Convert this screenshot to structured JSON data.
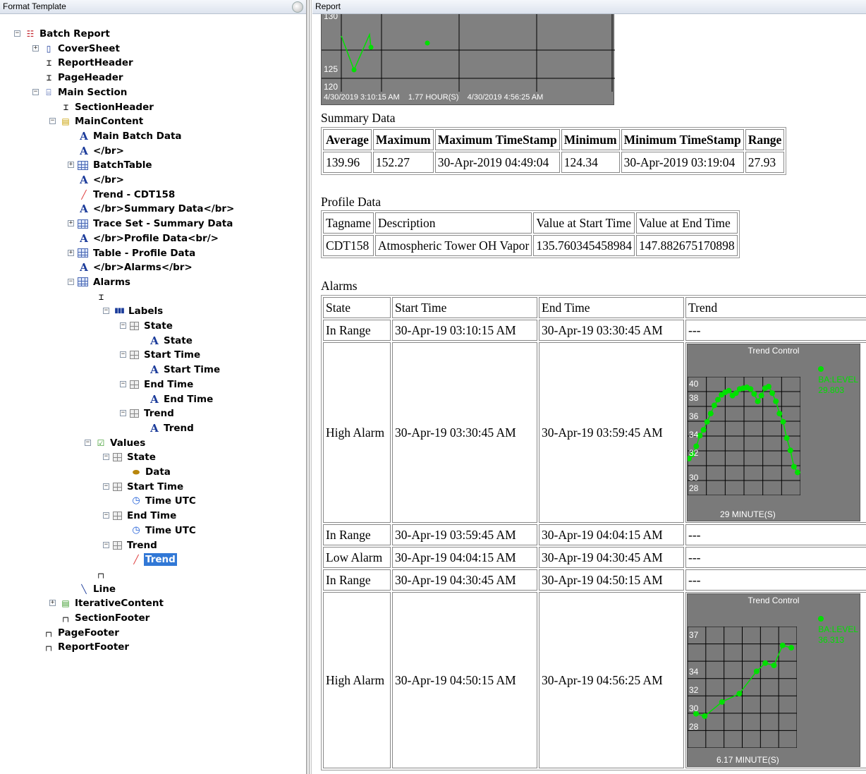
{
  "left_pane": {
    "title": "Format Template"
  },
  "right_pane": {
    "title": "Report"
  },
  "tree": [
    {
      "label": "Batch  Report",
      "icon": "batch-icon"
    },
    {
      "label": "CoverSheet",
      "icon": "document-icon"
    },
    {
      "label": "ReportHeader",
      "icon": "header-icon"
    },
    {
      "label": "PageHeader",
      "icon": "header-icon"
    },
    {
      "label": "Main Section",
      "icon": "section-icon"
    },
    {
      "label": "SectionHeader",
      "icon": "header-icon"
    },
    {
      "label": "MainContent",
      "icon": "folder-icon"
    },
    {
      "label": "Main Batch Data",
      "icon": "text-icon"
    },
    {
      "label": "</br>",
      "icon": "text-icon"
    },
    {
      "label": "BatchTable",
      "icon": "table-icon"
    },
    {
      "label": "</br>",
      "icon": "text-icon"
    },
    {
      "label": "Trend - CDT158",
      "icon": "trend-icon"
    },
    {
      "label": "</br>Summary Data</br>",
      "icon": "text-icon"
    },
    {
      "label": "Trace Set - Summary Data",
      "icon": "table-icon"
    },
    {
      "label": "</br>Profile Data<br/>",
      "icon": "text-icon"
    },
    {
      "label": "Table - Profile Data",
      "icon": "table-icon"
    },
    {
      "label": "</br>Alarms</br>",
      "icon": "text-icon"
    },
    {
      "label": "Alarms",
      "icon": "table-icon"
    },
    {
      "label": "",
      "icon": "header-icon"
    },
    {
      "label": "Labels",
      "icon": "labels-icon"
    },
    {
      "label": "State",
      "icon": "cell-icon"
    },
    {
      "label": "State",
      "icon": "text-icon"
    },
    {
      "label": "Start Time",
      "icon": "cell-icon"
    },
    {
      "label": "Start Time",
      "icon": "text-icon"
    },
    {
      "label": "End Time",
      "icon": "cell-icon"
    },
    {
      "label": "End Time",
      "icon": "text-icon"
    },
    {
      "label": "Trend",
      "icon": "cell-icon"
    },
    {
      "label": "Trend",
      "icon": "text-icon"
    },
    {
      "label": "Values",
      "icon": "values-icon"
    },
    {
      "label": "State",
      "icon": "cell-icon"
    },
    {
      "label": "Data",
      "icon": "tag-icon"
    },
    {
      "label": "Start Time",
      "icon": "cell-icon"
    },
    {
      "label": "Time UTC",
      "icon": "clock-icon"
    },
    {
      "label": "End Time",
      "icon": "cell-icon"
    },
    {
      "label": "Time UTC",
      "icon": "clock-icon"
    },
    {
      "label": "Trend",
      "icon": "cell-icon"
    },
    {
      "label": "Trend",
      "icon": "trend-icon"
    },
    {
      "label": "",
      "icon": "footer-icon"
    },
    {
      "label": "Line",
      "icon": "line-icon"
    },
    {
      "label": "IterativeContent",
      "icon": "folder-check-icon"
    },
    {
      "label": "SectionFooter",
      "icon": "footer-icon"
    },
    {
      "label": "PageFooter",
      "icon": "footer-icon"
    },
    {
      "label": "ReportFooter",
      "icon": "footer-icon"
    }
  ],
  "top_trend": {
    "y_labels": [
      "130",
      "125",
      "120"
    ],
    "start": "4/30/2019 3:10:15 AM",
    "duration": "1.77 HOUR(S)",
    "end": "4/30/2019 4:56:25 AM"
  },
  "summary": {
    "title": "Summary Data",
    "headers": [
      "Average",
      "Maximum",
      "Maximum TimeStamp",
      "Minimum",
      "Minimum TimeStamp",
      "Range"
    ],
    "row": [
      "139.96",
      "152.27",
      "30-Apr-2019 04:49:04",
      "124.34",
      "30-Apr-2019 03:19:04",
      "27.93"
    ]
  },
  "profile": {
    "title": "Profile Data",
    "headers": [
      "Tagname",
      "Description",
      "Value at Start Time",
      "Value at End Time"
    ],
    "row": [
      "CDT158",
      "Atmospheric Tower OH Vapor",
      "135.760345458984",
      "147.882675170898"
    ]
  },
  "alarms": {
    "title": "Alarms",
    "headers": [
      "State",
      "Start Time",
      "End Time",
      "Trend"
    ],
    "rows": [
      {
        "state": "In Range",
        "start": "30-Apr-19 03:10:15 AM",
        "end": "30-Apr-19 03:30:45 AM",
        "trend": "---"
      },
      {
        "state": "High Alarm",
        "start": "30-Apr-19 03:30:45 AM",
        "end": "30-Apr-19 03:59:45 AM",
        "trend": ""
      },
      {
        "state": "In Range",
        "start": "30-Apr-19 03:59:45 AM",
        "end": "30-Apr-19 04:04:15 AM",
        "trend": "---"
      },
      {
        "state": "Low Alarm",
        "start": "30-Apr-19 04:04:15 AM",
        "end": "30-Apr-19 04:30:45 AM",
        "trend": "---"
      },
      {
        "state": "In Range",
        "start": "30-Apr-19 04:30:45 AM",
        "end": "30-Apr-19 04:50:15 AM",
        "trend": "---"
      },
      {
        "state": "High Alarm",
        "start": "30-Apr-19 04:50:15 AM",
        "end": "30-Apr-19 04:56:25 AM",
        "trend": ""
      }
    ]
  },
  "trend1": {
    "title": "Trend Control",
    "legend_tag": "BA:LEVEL",
    "legend_value": "29.803",
    "y_labels": [
      "40",
      "38",
      "36",
      "34",
      "32",
      "30",
      "28"
    ],
    "duration": "29 MINUTE(S)",
    "points": [
      [
        0,
        31.5
      ],
      [
        1,
        32
      ],
      [
        2,
        33
      ],
      [
        3,
        34.3
      ],
      [
        4,
        35
      ],
      [
        5,
        36
      ],
      [
        6,
        37
      ],
      [
        7,
        38
      ],
      [
        8,
        38.7
      ],
      [
        9,
        39.3
      ],
      [
        10,
        39.6
      ],
      [
        11,
        39.8
      ],
      [
        12,
        39.2
      ],
      [
        13,
        39.5
      ],
      [
        14,
        40
      ],
      [
        15,
        40.1
      ],
      [
        16,
        40.2
      ],
      [
        17,
        40
      ],
      [
        18,
        39.4
      ],
      [
        19,
        38.5
      ],
      [
        20,
        39.2
      ],
      [
        21,
        40.1
      ],
      [
        22,
        40.3
      ],
      [
        23,
        39.5
      ],
      [
        24,
        38.5
      ],
      [
        25,
        37
      ],
      [
        26,
        36
      ],
      [
        27,
        34
      ],
      [
        28,
        32.5
      ],
      [
        29,
        30.5
      ],
      [
        30,
        29.8
      ]
    ]
  },
  "trend2": {
    "title": "Trend Control",
    "legend_tag": "BA:LEVEL",
    "legend_value": "36.313",
    "y_labels": [
      "37",
      "34",
      "32",
      "30",
      "28"
    ],
    "duration": "6.17 MINUTE(S)",
    "points": [
      [
        0,
        30.4
      ],
      [
        1,
        30.2
      ],
      [
        3,
        31.4
      ],
      [
        5,
        32.1
      ],
      [
        7,
        34
      ],
      [
        8,
        34.7
      ],
      [
        9,
        34.5
      ],
      [
        10,
        36.2
      ],
      [
        11,
        36
      ]
    ]
  }
}
